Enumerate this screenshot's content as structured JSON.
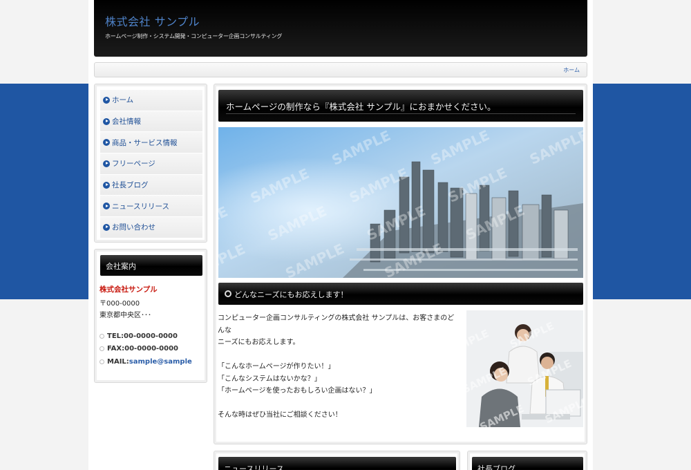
{
  "site": {
    "title": "株式会社 サンプル",
    "tagline": "ホームページ制作・システム開発・コンピューター企画コンサルティング"
  },
  "breadcrumb": {
    "home": "ホーム"
  },
  "menu": {
    "items": [
      {
        "label": "ホーム"
      },
      {
        "label": "会社情報"
      },
      {
        "label": "商品・サービス情報"
      },
      {
        "label": "フリーページ"
      },
      {
        "label": "社長ブログ"
      },
      {
        "label": "ニュースリリース"
      },
      {
        "label": "お問い合わせ"
      }
    ]
  },
  "company": {
    "heading": "会社案内",
    "name": "株式会社サンプル",
    "postal": "〒000-0000",
    "address": "東京都中央区･･･",
    "tel": "TEL:00-0000-0000",
    "fax": "FAX:00-0000-0000",
    "mail_prefix": "MAIL:",
    "mail": "sample@sample"
  },
  "main": {
    "heading": "ホームページの制作なら『株式会社 サンプル』におまかせください。",
    "hero_watermark": "SAMPLE",
    "sub_heading": "どんなニーズにもお応えします！",
    "paragraph1_line1": "コンピューター企画コンサルティングの株式会社 サンプルは、お客さまのどんな",
    "paragraph1_line2": "ニーズにもお応えします。",
    "quote1": "「こんなホームページが作りたい！」",
    "quote2": "「こんなシステムはないかな？」",
    "quote3": "「ホームページを使ったおもしろい企画はない？」",
    "closing": "そんな時はぜひ当社にご相談ください！"
  },
  "bottom": {
    "news_heading": "ニュースリリース",
    "blog_heading": "社長ブログ"
  },
  "colors": {
    "accent_blue": "#1f56a3",
    "company_red": "#c8190f",
    "header_black": "#000000"
  }
}
